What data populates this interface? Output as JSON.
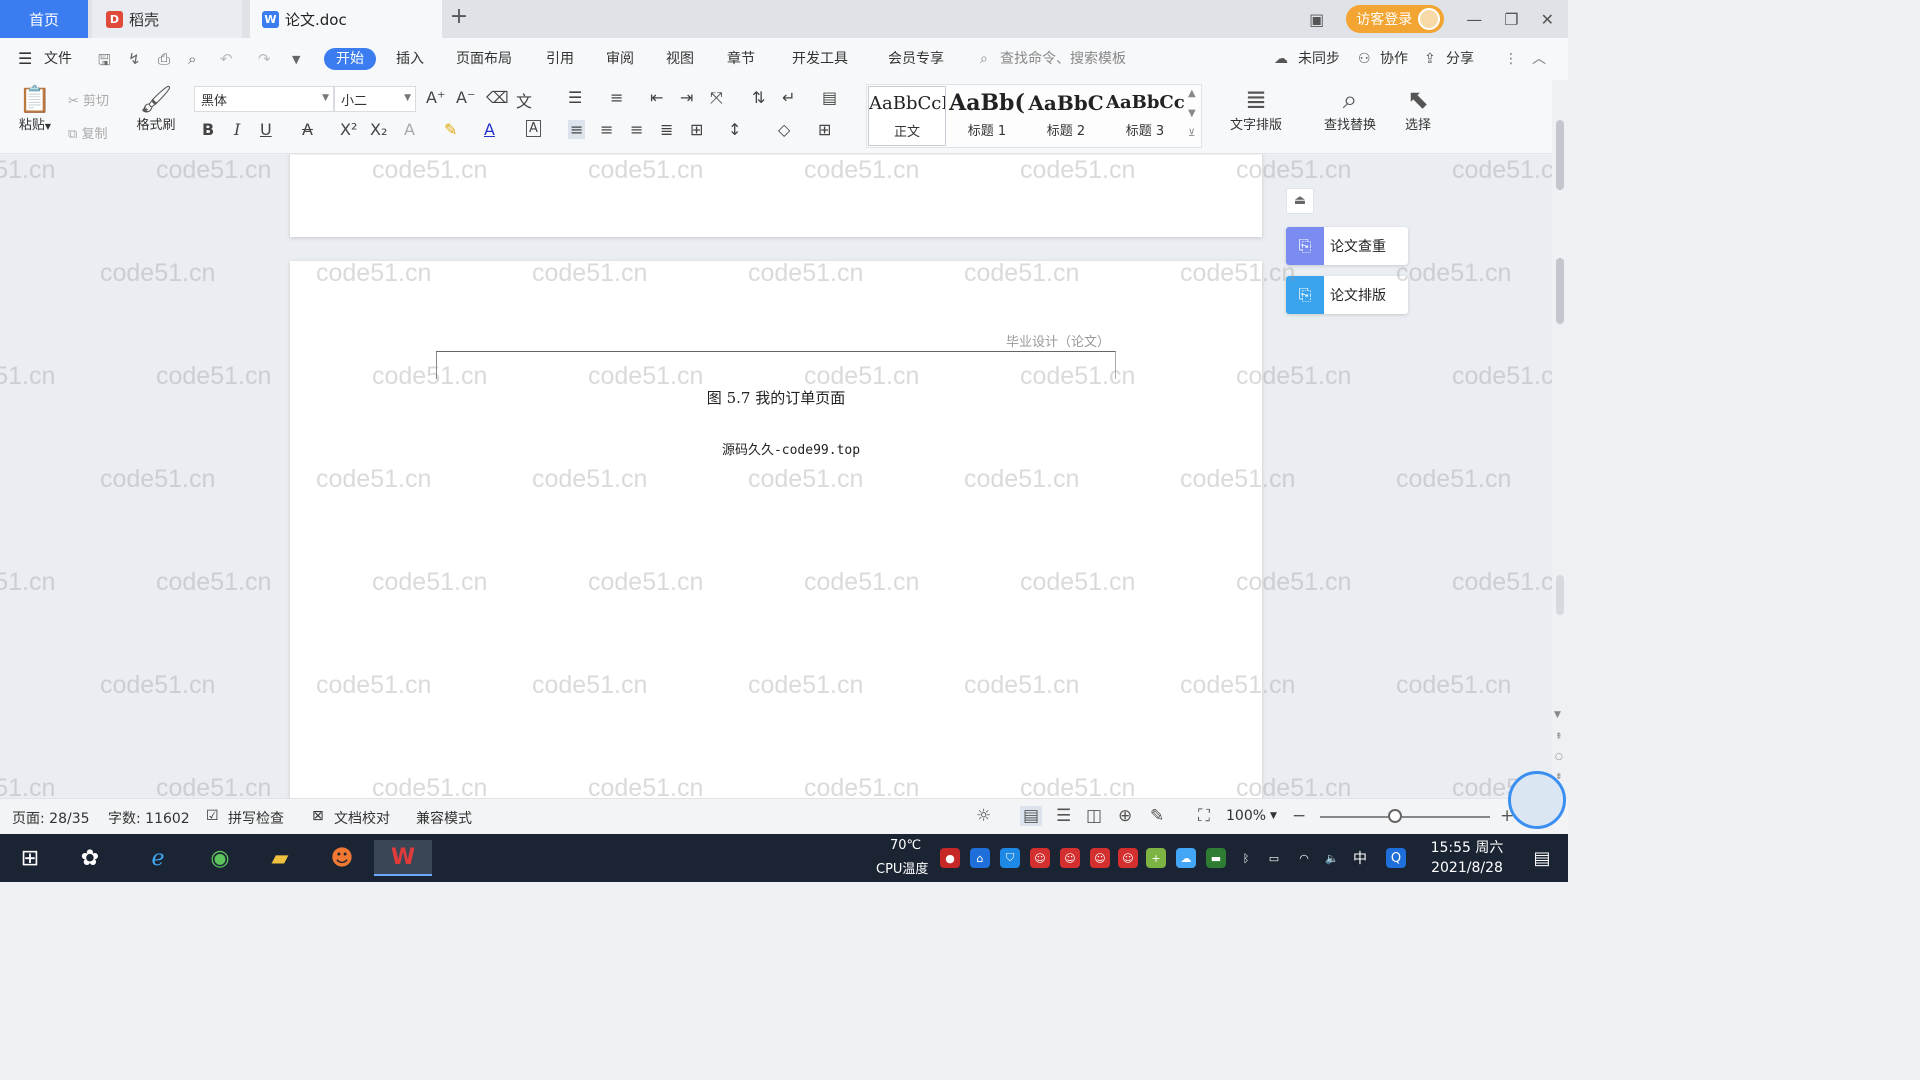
{
  "tabs": {
    "home": "首页",
    "daoke": "稻壳",
    "doc": "论文.doc",
    "add": "+"
  },
  "titlebar": {
    "guest_login": "访客登录"
  },
  "menu": {
    "file": "文件",
    "items": [
      "开始",
      "插入",
      "页面布局",
      "引用",
      "审阅",
      "视图",
      "章节",
      "开发工具",
      "会员专享"
    ],
    "search_placeholder": "查找命令、搜索模板",
    "unsynced": "未同步",
    "collaborate": "协作",
    "share": "分享"
  },
  "ribbon": {
    "paste": "粘贴",
    "cut": "剪切",
    "copy": "复制",
    "format_painter": "格式刷",
    "font_name": "黑体",
    "font_size": "小二",
    "styles": [
      {
        "preview": "AaBbCcI",
        "label": "正文"
      },
      {
        "preview": "AaBb(",
        "label": "标题 1"
      },
      {
        "preview": "AaBbC",
        "label": "标题 2"
      },
      {
        "preview": "AaBbCcl",
        "label": "标题 3"
      }
    ],
    "text_layout": "文字排版",
    "find_replace": "查找替换",
    "select": "选择"
  },
  "document": {
    "header_text": "毕业设计（论文）",
    "figure_caption": "图 5.7 我的订单页面",
    "source_text": "源码久久-code99.top",
    "watermark": "code51.cn"
  },
  "side_panel": {
    "check": "论文查重",
    "format": "论文排版"
  },
  "statusbar": {
    "page": "页面: 28/35",
    "words": "字数: 11602",
    "spell_check": "拼写检查",
    "doc_proof": "文档校对",
    "compat_mode": "兼容模式",
    "zoom": "100%",
    "zoom_level": 0.44
  },
  "taskbar": {
    "cpu_temp": "70℃",
    "cpu_label": "CPU温度",
    "ime": "中",
    "time": "15:55 周六",
    "date": "2021/8/28"
  },
  "colors": {
    "accent": "#3b7df0",
    "login": "#f3a533",
    "taskbar": "#1b2432"
  }
}
